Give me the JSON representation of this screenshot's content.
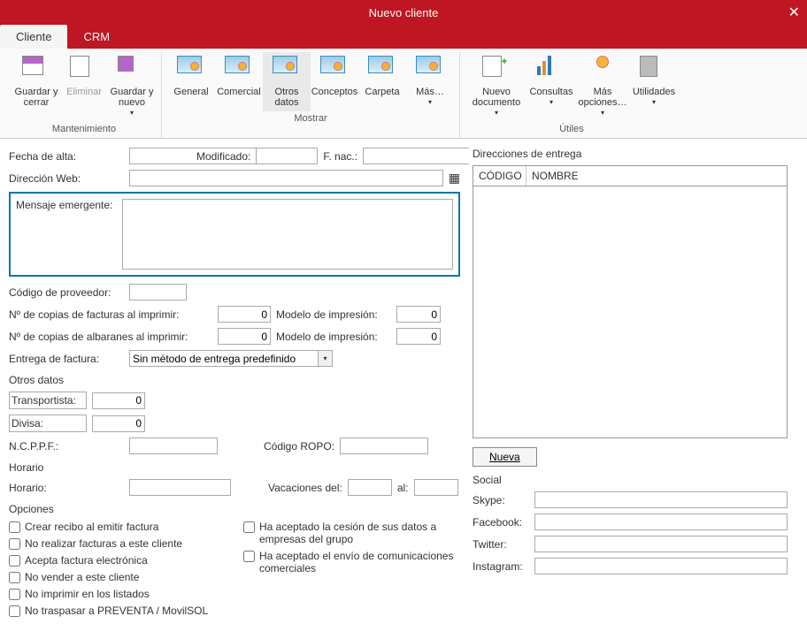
{
  "title": "Nuevo cliente",
  "tabs": {
    "cliente": "Cliente",
    "crm": "CRM"
  },
  "ribbon": {
    "mantenimiento": {
      "label": "Mantenimiento",
      "save_close": "Guardar y cerrar",
      "delete": "Eliminar",
      "save_new": "Guardar y nuevo"
    },
    "mostrar": {
      "label": "Mostrar",
      "general": "General",
      "comercial": "Comercial",
      "otros": "Otros datos",
      "conceptos": "Conceptos",
      "carpeta": "Carpeta",
      "mas": "Más…"
    },
    "utiles": {
      "label": "Útiles",
      "nuevo_doc": "Nuevo documento",
      "consultas": "Consultas",
      "mas_opc": "Más opciones…",
      "utilidades": "Utilidades"
    }
  },
  "fields": {
    "fecha_alta": "Fecha de alta:",
    "modificado": "Modificado:",
    "fnac": "F. nac.:",
    "direccion_web": "Dirección Web:",
    "mensaje_emergente": "Mensaje emergente:",
    "codigo_proveedor": "Código de proveedor:",
    "copias_facturas": "Nº de copias de facturas al imprimir:",
    "copias_albaranes": "Nº de copias de albaranes al imprimir:",
    "modelo_impresion": "Modelo de impresión:",
    "entrega_factura": "Entrega de factura:",
    "entrega_val": "Sin método de entrega predefinido",
    "transportista": "Transportista:",
    "divisa": "Divisa:",
    "ncppf": "N.C.P.P.F.:",
    "codigo_ropo": "Código ROPO:",
    "horario": "Horario:",
    "vacaciones_del": "Vacaciones del:",
    "al": "al:",
    "zero": "0"
  },
  "sections": {
    "otros_datos": "Otros datos",
    "horario": "Horario",
    "opciones": "Opciones",
    "direcciones": "Direcciones de entrega",
    "social": "Social"
  },
  "opciones": {
    "recibo": "Crear recibo al emitir factura",
    "no_facturas": "No realizar facturas a este cliente",
    "acepta_elec": "Acepta factura electrónica",
    "no_vender": "No vender a este cliente",
    "no_imprimir": "No imprimir en los listados",
    "no_traspasar": "No traspasar a PREVENTA / MovilSOL",
    "cesion": "Ha aceptado la cesión de sus datos a empresas del grupo",
    "comunicaciones": "Ha aceptado el envío de comunicaciones comerciales"
  },
  "direcciones_grid": {
    "codigo": "CÓDIGO",
    "nombre": "NOMBRE"
  },
  "buttons": {
    "nueva": "Nueva"
  },
  "social": {
    "skype": "Skype:",
    "facebook": "Facebook:",
    "twitter": "Twitter:",
    "instagram": "Instagram:"
  }
}
